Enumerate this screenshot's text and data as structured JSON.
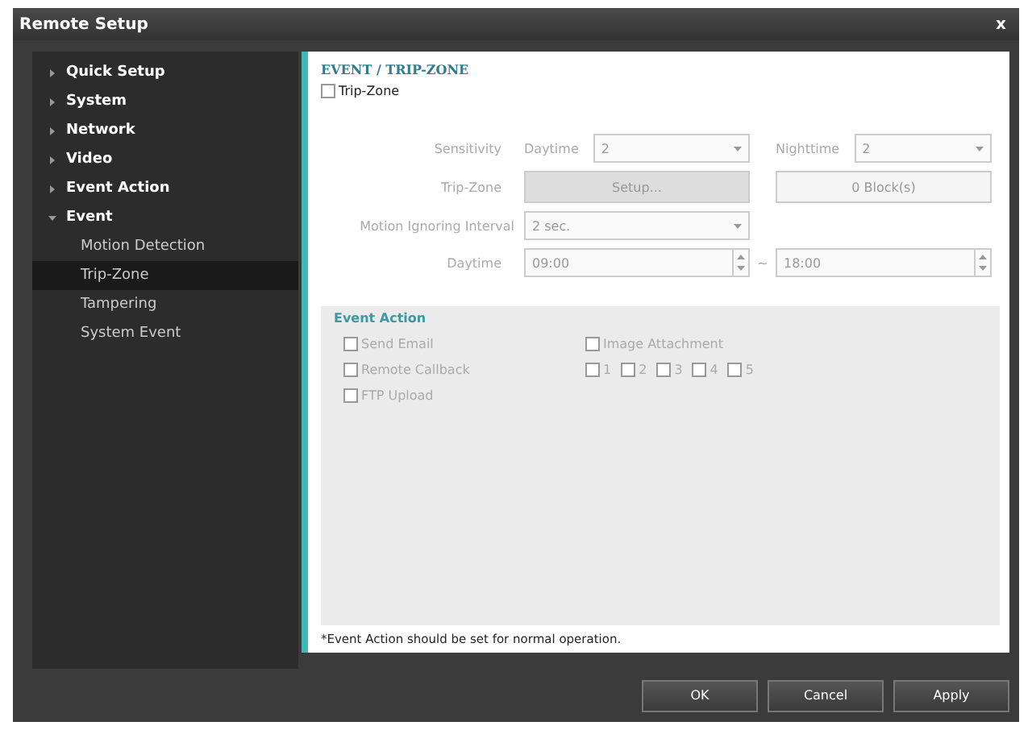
{
  "window": {
    "title": "Remote Setup",
    "close": "x"
  },
  "sidebar": {
    "items": [
      {
        "label": "Quick Setup",
        "expanded": false,
        "selected": false
      },
      {
        "label": "System",
        "expanded": false,
        "selected": false
      },
      {
        "label": "Network",
        "expanded": false,
        "selected": false
      },
      {
        "label": "Video",
        "expanded": false,
        "selected": false
      },
      {
        "label": "Event Action",
        "expanded": false,
        "selected": false
      },
      {
        "label": "Event",
        "expanded": true,
        "selected": false,
        "children": [
          {
            "label": "Motion Detection",
            "selected": false
          },
          {
            "label": "Trip-Zone",
            "selected": true
          },
          {
            "label": "Tampering",
            "selected": false
          },
          {
            "label": "System Event",
            "selected": false
          }
        ]
      }
    ]
  },
  "page": {
    "heading": "EVENT / TRIP-ZONE",
    "enable": {
      "label": "Trip-Zone",
      "checked": false
    },
    "settings": {
      "disabled": true,
      "sensitivity": {
        "label": "Sensitivity",
        "daytime_label": "Daytime",
        "daytime_value": "2",
        "nighttime_label": "Nighttime",
        "nighttime_value": "2"
      },
      "trip_zone": {
        "label": "Trip-Zone",
        "setup_button": "Setup...",
        "blocks_button": "0 Block(s)"
      },
      "interval": {
        "label": "Motion Ignoring Interval",
        "value": "2 sec."
      },
      "daytime": {
        "label": "Daytime",
        "from": "09:00",
        "separator": "~",
        "to": "18:00"
      }
    },
    "event_action": {
      "title": "Event Action",
      "disabled": true,
      "send_email": {
        "label": "Send Email",
        "checked": false
      },
      "image_attachment": {
        "label": "Image Attachment",
        "checked": false
      },
      "remote_callback": {
        "label": "Remote Callback",
        "checked": false
      },
      "callbacks": [
        {
          "label": "1",
          "checked": false
        },
        {
          "label": "2",
          "checked": false
        },
        {
          "label": "3",
          "checked": false
        },
        {
          "label": "4",
          "checked": false
        },
        {
          "label": "5",
          "checked": false
        }
      ],
      "ftp_upload": {
        "label": "FTP Upload",
        "checked": false
      }
    },
    "note": "*Event Action should be set for normal operation."
  },
  "buttons": [
    "OK",
    "Cancel",
    "Apply"
  ]
}
